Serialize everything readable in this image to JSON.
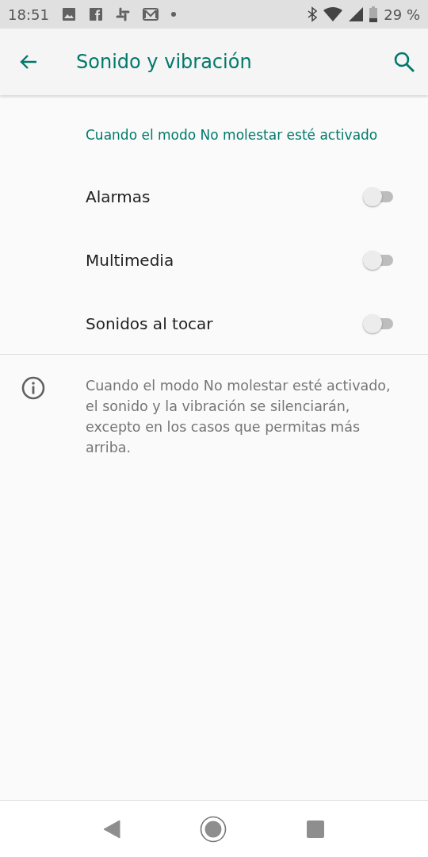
{
  "status_bar": {
    "time": "18:51",
    "battery": "29 %"
  },
  "app_bar": {
    "title": "Sonido y vibración"
  },
  "section": {
    "title": "Cuando el modo No molestar esté activado",
    "items": [
      {
        "label": "Alarmas",
        "checked": false
      },
      {
        "label": "Multimedia",
        "checked": false
      },
      {
        "label": "Sonidos al tocar",
        "checked": false
      }
    ]
  },
  "info": {
    "text": "Cuando el modo No molestar esté activado, el sonido y la vibración se silenciarán, excepto en los casos que permitas más arriba."
  }
}
